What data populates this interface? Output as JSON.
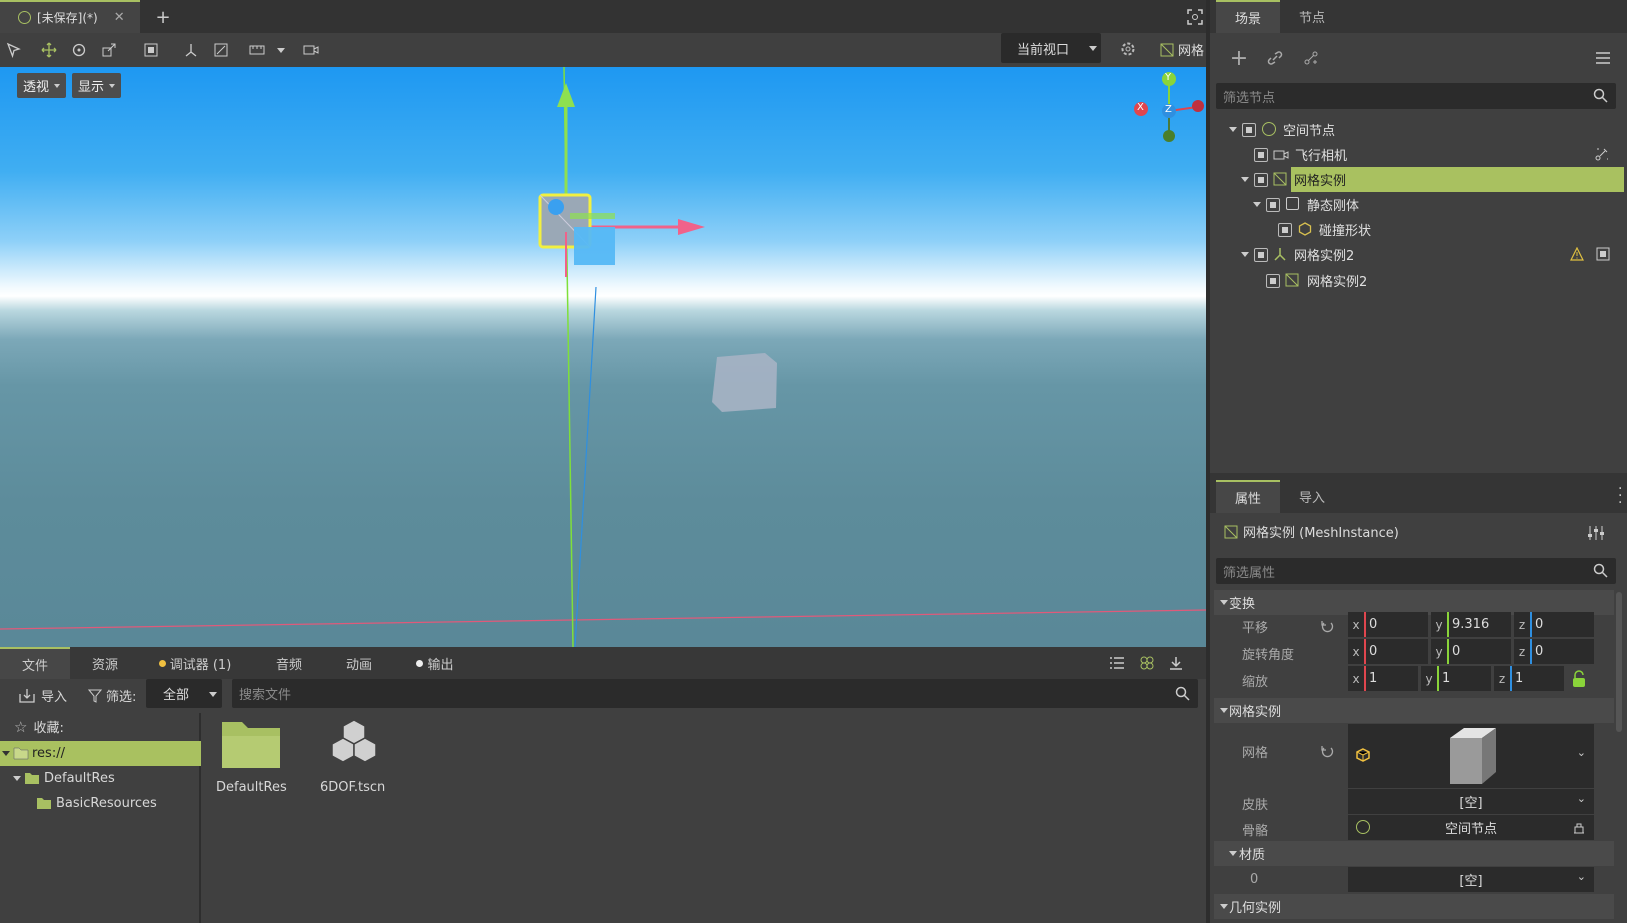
{
  "editor": {
    "doc_tab_label": "[未保存](*)",
    "viewport_dropdown": "当前视口",
    "grid_label": "网格",
    "perspective_label": "透视",
    "display_label": "显示",
    "gizmo": {
      "x": "X",
      "y": "Y",
      "z": "Z"
    }
  },
  "scene_dock": {
    "tabs": [
      "场景",
      "节点"
    ],
    "filter_placeholder": "筛选节点",
    "tree": [
      {
        "label": "空间节点",
        "icon": "spatial-icon"
      },
      {
        "label": "飞行相机",
        "icon": "camera-icon"
      },
      {
        "label": "网格实例",
        "icon": "mesh-instance-icon",
        "selected": true
      },
      {
        "label": "静态刚体",
        "icon": "static-body-icon"
      },
      {
        "label": "碰撞形状",
        "icon": "collision-shape-icon"
      },
      {
        "label": "网格实例2",
        "icon": "skeleton-icon"
      },
      {
        "label": "网格实例2",
        "icon": "mesh-instance-icon"
      }
    ]
  },
  "inspector": {
    "tabs": [
      "属性",
      "导入"
    ],
    "node_title": "网格实例 (MeshInstance)",
    "filter_placeholder": "筛选属性",
    "transform_section": "变换",
    "translation": {
      "label": "平移",
      "x": "0",
      "y": "9.316",
      "z": "0"
    },
    "rotation": {
      "label": "旋转角度",
      "x": "0",
      "y": "0",
      "z": "0"
    },
    "scale": {
      "label": "缩放",
      "x": "1",
      "y": "1",
      "z": "1"
    },
    "mesh_section": "网格实例",
    "mesh_label": "网格",
    "skin_label": "皮肤",
    "skin_value": "[空]",
    "skeleton_label": "骨骼",
    "skeleton_value": "空间节点",
    "material_section": "材质",
    "material_index": "0",
    "material_value": "[空]",
    "geometry_section": "几何实例"
  },
  "bottom_panel": {
    "tabs": [
      "文件",
      "资源",
      "调试器 (1)",
      "音频",
      "动画",
      "输出"
    ],
    "import_label": "导入",
    "filter_label": "筛选:",
    "filter_value": "全部",
    "search_placeholder": "搜索文件",
    "favorites_label": "收藏:",
    "tree": [
      "res://",
      "DefaultRes",
      "BasicResources"
    ],
    "files": [
      {
        "name": "DefaultRes",
        "type": "folder"
      },
      {
        "name": "6DOF.tscn",
        "type": "scene"
      }
    ]
  },
  "colors": {
    "accent": "#a8c062",
    "selection": "#a9c160",
    "axis_x": "#e0464e",
    "axis_y": "#8ad43a",
    "axis_z": "#2f8fe0"
  }
}
